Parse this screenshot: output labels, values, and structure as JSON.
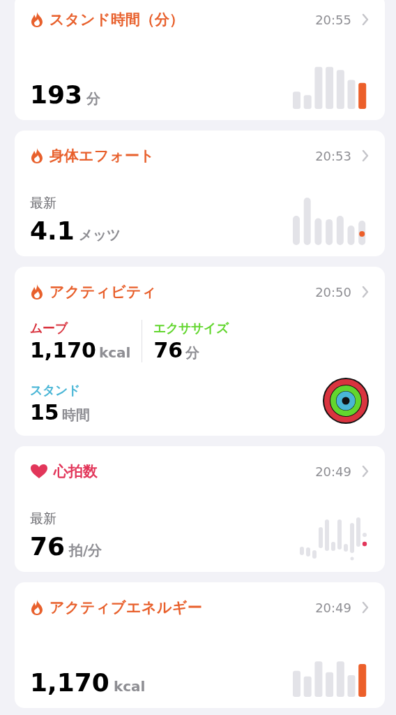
{
  "cards": [
    {
      "kind": "bars",
      "title": "スタンド時間（分）",
      "color": "#e8602c",
      "time": "20:55",
      "value": "193",
      "unit": "分"
    },
    {
      "kind": "dots",
      "title": "身体エフォート",
      "color": "#e8602c",
      "time": "20:53",
      "caption": "最新",
      "value": "4.1",
      "unit": "メッツ"
    },
    {
      "kind": "rings",
      "title": "アクティビティ",
      "color": "#e8602c",
      "time": "20:50",
      "metrics": [
        {
          "label": "ムーブ",
          "color": "#d9343f",
          "value": "1,170",
          "unit": "kcal"
        },
        {
          "label": "エクササイズ",
          "color": "#62d62e",
          "value": "76",
          "unit": "分"
        },
        {
          "label": "スタンド",
          "color": "#4ab6d6",
          "value": "15",
          "unit": "時間"
        }
      ]
    },
    {
      "kind": "heart",
      "title": "心拍数",
      "color": "#e2365a",
      "time": "20:49",
      "caption": "最新",
      "value": "76",
      "unit": "拍/分"
    },
    {
      "kind": "bars",
      "title": "アクティブエネルギー",
      "color": "#e8602c",
      "time": "20:49",
      "value": "1,170",
      "unit": "kcal"
    }
  ]
}
